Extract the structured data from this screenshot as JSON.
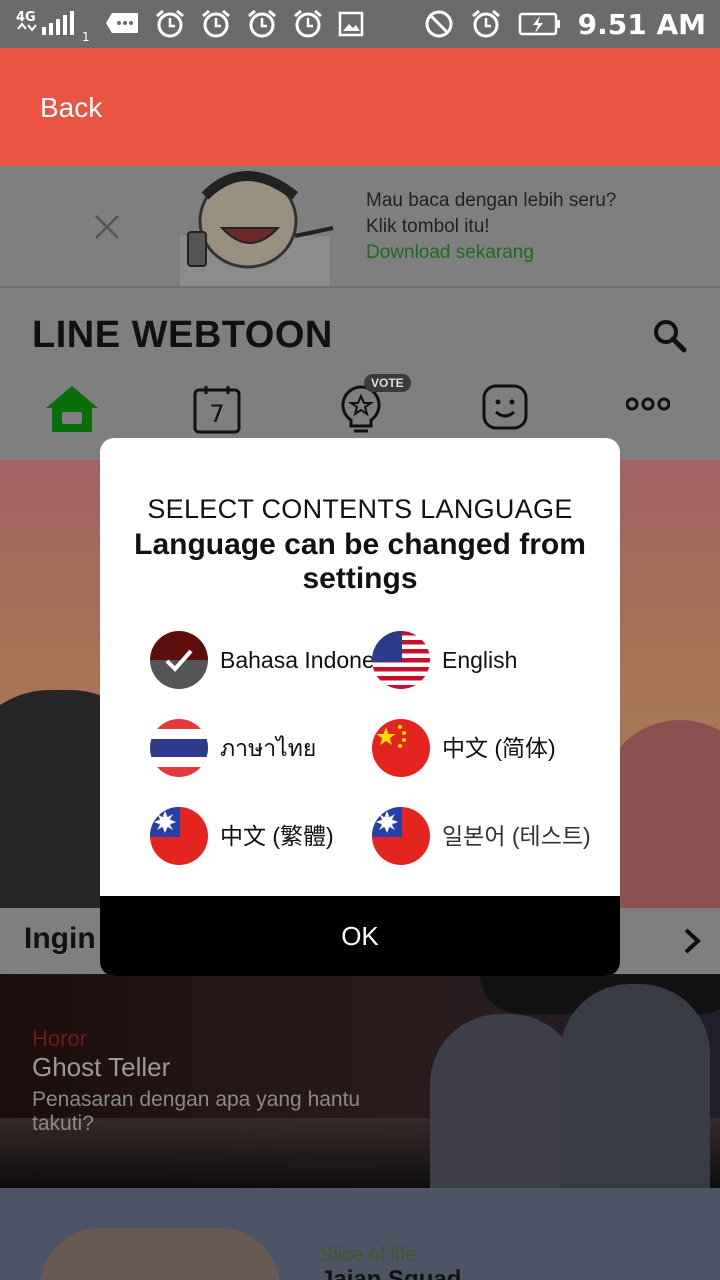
{
  "status_bar": {
    "network": "4G",
    "sim": "1",
    "time": "9.51 AM"
  },
  "header": {
    "back_label": "Back"
  },
  "promo": {
    "line1": "Mau baca dengan lebih seru?",
    "line2": "Klik tombol itu!",
    "link": "Download sekarang"
  },
  "app": {
    "logo": "LINE WEBTOON",
    "vote_badge": "VOTE",
    "calendar_day": "7"
  },
  "row": {
    "title": "Ingin"
  },
  "card1": {
    "genre": "Horor",
    "title": "Ghost Teller",
    "description": "Penasaran dengan apa yang hantu takuti?"
  },
  "card2": {
    "genre": "Slice of life",
    "title": "Jaian Squad"
  },
  "modal": {
    "heading": "SELECT CONTENTS LANGUAGE",
    "subheading": "Language can be changed from settings",
    "languages": [
      {
        "label": "Bahasa Indonesia",
        "flag": "indonesia-flag",
        "selected": true
      },
      {
        "label": "English",
        "flag": "us-flag",
        "selected": false
      },
      {
        "label": "ภาษาไทย",
        "flag": "thailand-flag",
        "selected": false
      },
      {
        "label": "中文 (简体)",
        "flag": "china-flag",
        "selected": false
      },
      {
        "label": "中文 (繁體)",
        "flag": "taiwan-flag",
        "selected": false
      },
      {
        "label": "일본어 (테스트)",
        "flag": "taiwan-flag",
        "selected": false
      }
    ],
    "ok_label": "OK"
  }
}
